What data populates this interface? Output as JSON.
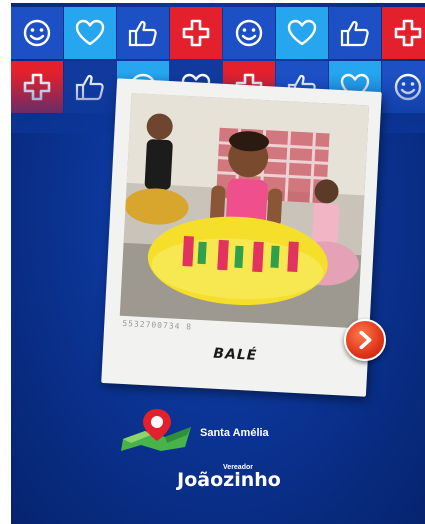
{
  "tiles": {
    "row1": [
      {
        "icon": "smiley-icon",
        "color": "blue"
      },
      {
        "icon": "heart-icon",
        "color": "cyan"
      },
      {
        "icon": "thumbs-up-icon",
        "color": "blue"
      },
      {
        "icon": "cross-icon",
        "color": "red"
      },
      {
        "icon": "smiley-icon",
        "color": "blue"
      },
      {
        "icon": "heart-icon",
        "color": "cyan"
      },
      {
        "icon": "thumbs-up-icon",
        "color": "blue"
      },
      {
        "icon": "cross-icon",
        "color": "red"
      }
    ],
    "row2": [
      {
        "icon": "cross-icon",
        "color": "red"
      },
      {
        "icon": "thumbs-up-icon",
        "color": "navy"
      },
      {
        "icon": "smiley-icon",
        "color": "cyan"
      },
      {
        "icon": "heart-icon",
        "color": "navy"
      },
      {
        "icon": "cross-icon",
        "color": "red"
      },
      {
        "icon": "thumbs-up-icon",
        "color": "blue"
      },
      {
        "icon": "heart-icon",
        "color": "cyan"
      },
      {
        "icon": "smiley-icon",
        "color": "blue"
      }
    ]
  },
  "colors": {
    "red": "#e3202b",
    "cyan": "#25a6ee",
    "blue": "#1c50c4",
    "navy": "#123a9e",
    "background": "#0b3597"
  },
  "card": {
    "caption": "BALÉ",
    "serial": "5532700734 8",
    "photo_alt": "Girl in a pink top and a yellow ruffled skirt posing with other dancers"
  },
  "next_button": {
    "icon": "chevron-right-icon"
  },
  "footer": {
    "city": "Santa Amélia",
    "brand_sub": "Vereador",
    "brand_name": "Joãozinho"
  }
}
